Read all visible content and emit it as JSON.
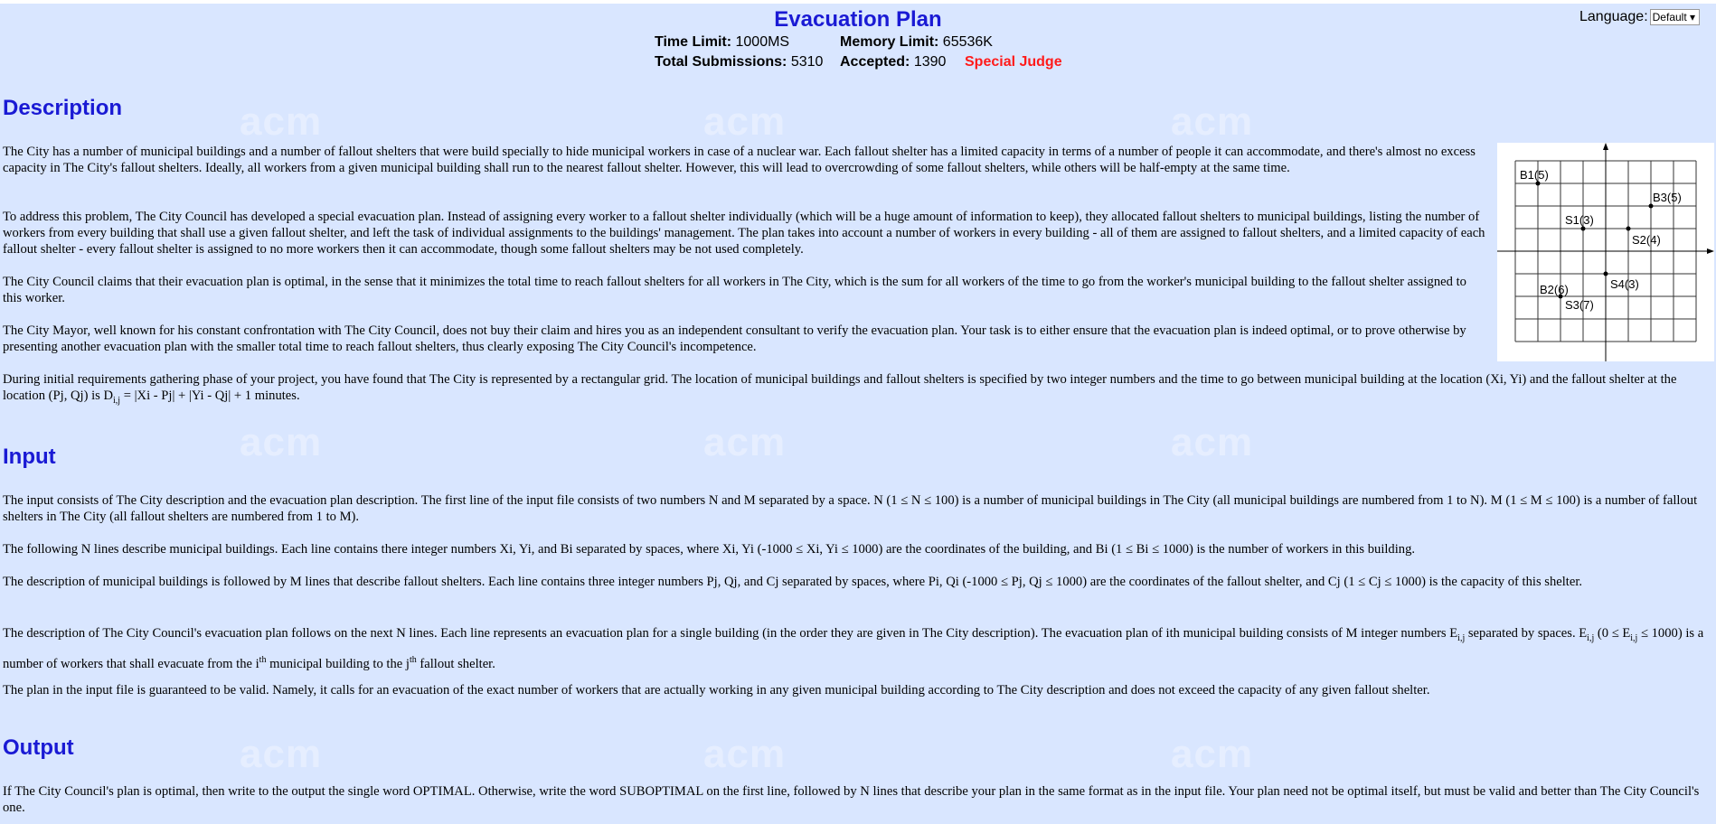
{
  "page": {
    "title": "Evacuation Plan",
    "time_limit_label": "Time Limit:",
    "time_limit_value": "1000MS",
    "memory_limit_label": "Memory Limit:",
    "memory_limit_value": "65536K",
    "total_submissions_label": "Total Submissions:",
    "total_submissions_value": "5310",
    "accepted_label": "Accepted:",
    "accepted_value": "1390",
    "special_judge": "Special Judge",
    "language_label": "Language:",
    "language_value": "Default"
  },
  "watermark": {
    "text": "acm"
  },
  "sections": {
    "description_heading": "Description",
    "input_heading": "Input",
    "output_heading": "Output"
  },
  "description": {
    "p1": "The City has a number of municipal buildings and a number of fallout shelters that were build specially to hide municipal workers in case of a nuclear war. Each fallout shelter has a limited capacity in terms of a number of people it can accommodate, and there's almost no excess capacity in The City's fallout shelters. Ideally, all workers from a given municipal building shall run to the nearest fallout shelter. However, this will lead to overcrowding of some fallout shelters, while others will be half-empty at the same time.",
    "p2": "To address this problem, The City Council has developed a special evacuation plan. Instead of assigning every worker to a fallout shelter individually (which will be a huge amount of information to keep), they allocated fallout shelters to municipal buildings, listing the number of workers from every building that shall use a given fallout shelter, and left the task of individual assignments to the buildings' management. The plan takes into account a number of workers in every building - all of them are assigned to fallout shelters, and a limited capacity of each fallout shelter - every fallout shelter is assigned to no more workers then it can accommodate, though some fallout shelters may be not used completely.",
    "p3": "The City Council claims that their evacuation plan is optimal, in the sense that it minimizes the total time to reach fallout shelters for all workers in The City, which is the sum for all workers of the time to go from the worker's municipal building to the fallout shelter assigned to this worker.",
    "p4": "The City Mayor, well known for his constant confrontation with The City Council, does not buy their claim and hires you as an independent consultant to verify the evacuation plan. Your task is to either ensure that the evacuation plan is indeed optimal, or to prove otherwise by presenting another evacuation plan with the smaller total time to reach fallout shelters, thus clearly exposing The City Council's incompetence.",
    "p5_a": "During initial requirements gathering phase of your project, you have found that The City is represented by a rectangular grid. The location of municipal buildings and fallout shelters is specified by two integer numbers and the time to go between municipal building at the location (Xi, Yi) and the fallout shelter at the location (Pj, Qj) is D",
    "p5_sub": "i,j",
    "p5_b": " = |Xi - Pj| + |Yi - Qj| + 1 minutes."
  },
  "figure": {
    "labels": [
      "B1(5)",
      "B3(5)",
      "S1(3)",
      "S2(4)",
      "S4(3)",
      "B2(6)",
      "S3(7)"
    ]
  },
  "input": {
    "p1": "The input consists of The City description and the evacuation plan description. The first line of the input file consists of two numbers N and M separated by a space. N (1 ≤ N ≤ 100) is a number of municipal buildings in The City (all municipal buildings are numbered from 1 to N). M (1 ≤ M ≤ 100) is a number of fallout shelters in The City (all fallout shelters are numbered from 1 to M).",
    "p2": "The following N lines describe municipal buildings. Each line contains there integer numbers Xi, Yi, and Bi separated by spaces, where Xi, Yi (-1000 ≤ Xi, Yi ≤ 1000) are the coordinates of the building, and Bi (1 ≤ Bi ≤ 1000) is the number of workers in this building.",
    "p3": "The description of municipal buildings is followed by M lines that describe fallout shelters. Each line contains three integer numbers Pj, Qj, and Cj separated by spaces, where Pi, Qi (-1000 ≤ Pj, Qj ≤ 1000) are the coordinates of the fallout shelter, and Cj (1 ≤ Cj ≤ 1000) is the capacity of this shelter.",
    "p4_a": "The description of The City Council's evacuation plan follows on the next N lines. Each line represents an evacuation plan for a single building (in the order they are given in The City description). The evacuation plan of ith municipal building consists of M integer numbers E",
    "p4_sub1": "i,j",
    "p4_b": " separated by spaces. E",
    "p4_sub2": "i,j",
    "p4_c": " (0 ≤ E",
    "p4_sub3": "i,j",
    "p4_d": " ≤ 1000) is a number of workers that shall evacuate from the i",
    "p4_sup1": "th",
    "p4_e": " municipal building to the j",
    "p4_sup2": "th",
    "p4_f": " fallout shelter.",
    "p5": "The plan in the input file is guaranteed to be valid. Namely, it calls for an evacuation of the exact number of workers that are actually working in any given municipal building according to The City description and does not exceed the capacity of any given fallout shelter."
  },
  "output": {
    "p1": "If The City Council's plan is optimal, then write to the output the single word OPTIMAL. Otherwise, write the word SUBOPTIMAL on the first line, followed by N lines that describe your plan in the same format as in the input file. Your plan need not be optimal itself, but must be valid and better than The City Council's one."
  }
}
